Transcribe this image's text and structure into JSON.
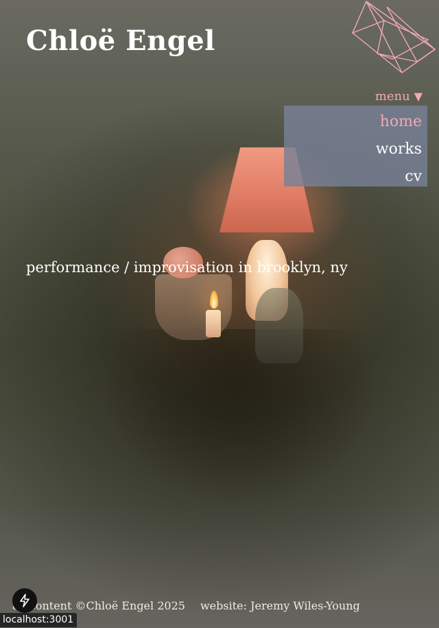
{
  "header": {
    "title": "Chloë Engel"
  },
  "logo": {
    "icon": "geometric-pink-logo-icon",
    "color": "#f4a7b9"
  },
  "menu": {
    "toggle_label": "menu",
    "toggle_icon": "triangle-down-icon",
    "items": [
      {
        "label": "home",
        "active": true
      },
      {
        "label": "works",
        "active": false
      },
      {
        "label": "cv",
        "active": false
      }
    ],
    "active_color": "#f4a7b9"
  },
  "hero": {
    "tagline": "performance / improvisation in brooklyn, ny"
  },
  "footer": {
    "copyright": "all content ©Chloë Engel 2025",
    "credit": "website: Jeremy Wiles-Young"
  },
  "dev_overlay": {
    "icon": "lightning-icon",
    "url_label": "localhost:3001"
  }
}
